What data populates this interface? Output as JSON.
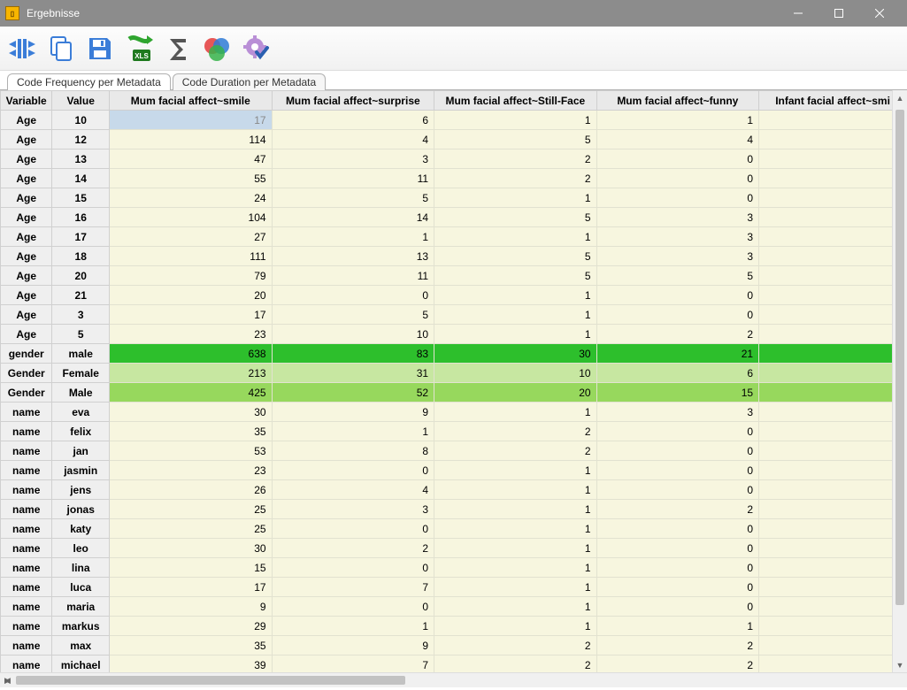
{
  "window": {
    "title": "Ergebnisse"
  },
  "tabs": [
    {
      "label": "Code Frequency per Metadata",
      "active": true
    },
    {
      "label": "Code Duration per Metadata",
      "active": false
    }
  ],
  "columns": [
    "Variable",
    "Value",
    "Mum facial affect~smile",
    "Mum facial affect~surprise",
    "Mum facial affect~Still-Face",
    "Mum facial affect~funny",
    "Infant facial affect~smi"
  ],
  "rows": [
    {
      "variable": "Age",
      "value": "10",
      "cells": [
        17,
        6,
        1,
        1,
        ""
      ],
      "style": "sel"
    },
    {
      "variable": "Age",
      "value": "12",
      "cells": [
        114,
        4,
        5,
        4,
        ""
      ]
    },
    {
      "variable": "Age",
      "value": "13",
      "cells": [
        47,
        3,
        2,
        0,
        ""
      ]
    },
    {
      "variable": "Age",
      "value": "14",
      "cells": [
        55,
        11,
        2,
        0,
        ""
      ]
    },
    {
      "variable": "Age",
      "value": "15",
      "cells": [
        24,
        5,
        1,
        0,
        ""
      ]
    },
    {
      "variable": "Age",
      "value": "16",
      "cells": [
        104,
        14,
        5,
        3,
        ""
      ]
    },
    {
      "variable": "Age",
      "value": "17",
      "cells": [
        27,
        1,
        1,
        3,
        ""
      ]
    },
    {
      "variable": "Age",
      "value": "18",
      "cells": [
        111,
        13,
        5,
        3,
        ""
      ]
    },
    {
      "variable": "Age",
      "value": "20",
      "cells": [
        79,
        11,
        5,
        5,
        ""
      ]
    },
    {
      "variable": "Age",
      "value": "21",
      "cells": [
        20,
        0,
        1,
        0,
        ""
      ]
    },
    {
      "variable": "Age",
      "value": "3",
      "cells": [
        17,
        5,
        1,
        0,
        ""
      ]
    },
    {
      "variable": "Age",
      "value": "5",
      "cells": [
        23,
        10,
        1,
        2,
        ""
      ]
    },
    {
      "variable": "gender",
      "value": "male",
      "cells": [
        638,
        83,
        30,
        21,
        ""
      ],
      "style": "bright"
    },
    {
      "variable": "Gender",
      "value": "Female",
      "cells": [
        213,
        31,
        10,
        6,
        ""
      ],
      "style": "light"
    },
    {
      "variable": "Gender",
      "value": "Male",
      "cells": [
        425,
        52,
        20,
        15,
        ""
      ],
      "style": "med"
    },
    {
      "variable": "name",
      "value": "eva",
      "cells": [
        30,
        9,
        1,
        3,
        ""
      ]
    },
    {
      "variable": "name",
      "value": "felix",
      "cells": [
        35,
        1,
        2,
        0,
        ""
      ]
    },
    {
      "variable": "name",
      "value": "jan",
      "cells": [
        53,
        8,
        2,
        0,
        ""
      ]
    },
    {
      "variable": "name",
      "value": "jasmin",
      "cells": [
        23,
        0,
        1,
        0,
        ""
      ]
    },
    {
      "variable": "name",
      "value": "jens",
      "cells": [
        26,
        4,
        1,
        0,
        ""
      ]
    },
    {
      "variable": "name",
      "value": "jonas",
      "cells": [
        25,
        3,
        1,
        2,
        ""
      ]
    },
    {
      "variable": "name",
      "value": "katy",
      "cells": [
        25,
        0,
        1,
        0,
        ""
      ]
    },
    {
      "variable": "name",
      "value": "leo",
      "cells": [
        30,
        2,
        1,
        0,
        ""
      ]
    },
    {
      "variable": "name",
      "value": "lina",
      "cells": [
        15,
        0,
        1,
        0,
        ""
      ]
    },
    {
      "variable": "name",
      "value": "luca",
      "cells": [
        17,
        7,
        1,
        0,
        ""
      ]
    },
    {
      "variable": "name",
      "value": "maria",
      "cells": [
        9,
        0,
        1,
        0,
        ""
      ]
    },
    {
      "variable": "name",
      "value": "markus",
      "cells": [
        29,
        1,
        1,
        1,
        ""
      ]
    },
    {
      "variable": "name",
      "value": "max",
      "cells": [
        35,
        9,
        2,
        2,
        ""
      ]
    },
    {
      "variable": "name",
      "value": "michael",
      "cells": [
        39,
        7,
        2,
        2,
        ""
      ]
    }
  ]
}
